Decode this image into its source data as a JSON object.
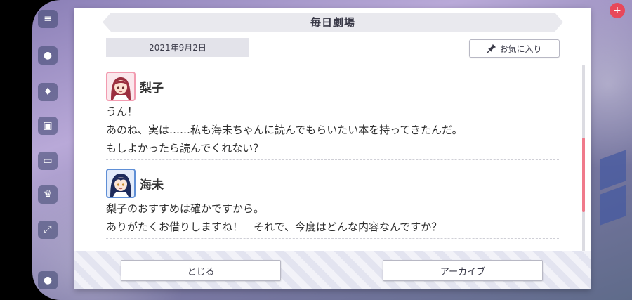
{
  "dialog": {
    "title": "毎日劇場",
    "date": "2021年9月2日",
    "favorite_label": "お気に入り",
    "close_label": "とじる",
    "archive_label": "アーカイブ"
  },
  "messages": [
    {
      "speaker": "梨子",
      "avatar": "riko-avatar",
      "lines": [
        "うん！",
        "あのね、実は……私も海未ちゃんに読んでもらいたい本を持ってきたんだ。",
        "もしよかったら読んでくれない？"
      ]
    },
    {
      "speaker": "海未",
      "avatar": "umi-avatar",
      "lines": [
        "梨子のおすすめは確かですから。",
        "ありがたくお借りしますね！　それで、今度はどんな内容なんですか？"
      ]
    }
  ],
  "colors": {
    "scroll_thumb": "#f07a8b",
    "riko_accent": "#f29bb0",
    "umi_accent": "#5f8fd6"
  }
}
